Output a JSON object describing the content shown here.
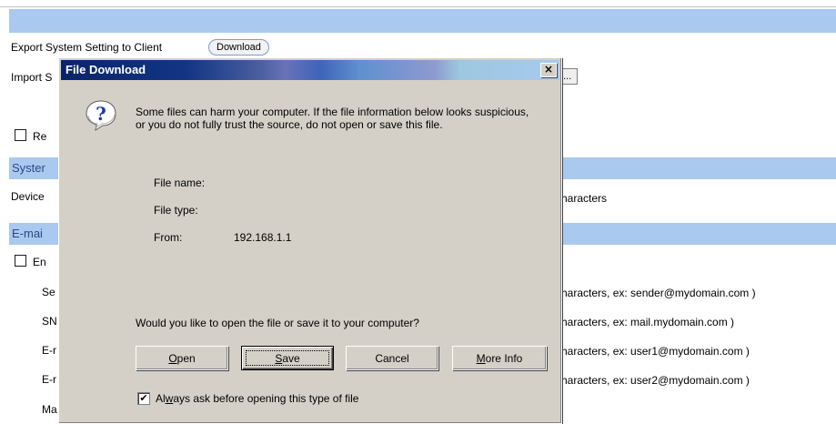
{
  "background": {
    "export_label": "Export System Setting to Client",
    "download_button": "Download",
    "import_label_partial": "Import S",
    "browse_button_partial": "e...",
    "restore_checkbox_partial": "Re",
    "section_system_partial": "Syster",
    "device_label_partial": "Device",
    "device_hint_partial": "haracters",
    "section_email_partial": "E-mai",
    "enable_checkbox_partial": "En",
    "rows": [
      {
        "label": "Se",
        "hint": "haracters, ex: sender@mydomain.com )"
      },
      {
        "label": "SN",
        "hint": "haracters, ex: mail.mydomain.com )"
      },
      {
        "label": "E-r",
        "hint": "haracters, ex: user1@mydomain.com )"
      },
      {
        "label": "E-r",
        "hint": "haracters, ex: user2@mydomain.com )"
      },
      {
        "label": "Ma",
        "hint": ""
      }
    ]
  },
  "dialog": {
    "title": "File Download",
    "close_glyph": "×",
    "warning_text": "Some files can harm your computer. If the file information below looks suspicious, or you do not fully trust the source, do not open or save this file.",
    "file_name_label": "File name:",
    "file_name_value": "",
    "file_type_label": "File type:",
    "file_type_value": "",
    "from_label": "From:",
    "from_value": "192.168.1.1",
    "question": "Would you like to open the file or save it to your computer?",
    "buttons": {
      "open_access": "O",
      "open_rest": "pen",
      "save_access": "S",
      "save_rest": "ave",
      "cancel": "Cancel",
      "moreinfo_access": "M",
      "moreinfo_rest": "ore Info"
    },
    "always_ask_pre": "Al",
    "always_ask_access": "w",
    "always_ask_post": "ays ask before opening this type of file",
    "always_ask_checked": true,
    "checkmark": "✔",
    "icon": "question-icon"
  },
  "colors": {
    "section_band": "#a9c9ef",
    "dialog_face": "#d4d0c8",
    "title_start": "#0a246a",
    "title_end": "#a6caf0"
  }
}
